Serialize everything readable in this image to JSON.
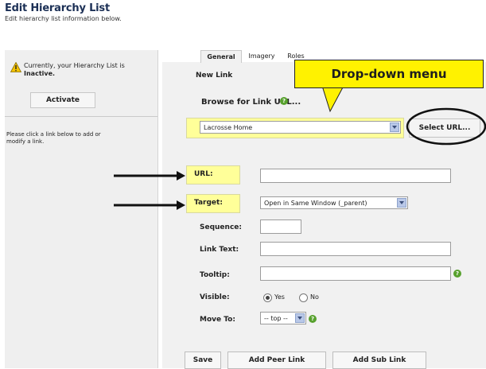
{
  "header": {
    "title": "Edit Hierarchy List",
    "subtitle": "Edit hierarchy list information below."
  },
  "sidebar": {
    "status_prefix": "Currently, your Hierarchy List is",
    "status_value": "Inactive.",
    "activate_label": "Activate",
    "help_text": "Please click a link below to add or modify a link."
  },
  "tabs": [
    "General",
    "Imagery",
    "Roles"
  ],
  "form": {
    "section_title": "New Link",
    "browse_label": "Browse for Link URL...",
    "dropdown_value": "Lacrosse Home",
    "select_url_label": "Select URL...",
    "url_label": "URL:",
    "url_value": "",
    "target_label": "Target:",
    "target_value": "Open in Same Window (_parent)",
    "sequence_label": "Sequence:",
    "link_text_label": "Link Text:",
    "tooltip_label": "Tooltip:",
    "visible_label": "Visible:",
    "visible_yes": "Yes",
    "visible_no": "No",
    "visible_selected": "Yes",
    "move_to_label": "Move To:",
    "move_to_value": "-- top --"
  },
  "actions": {
    "save": "Save",
    "add_peer": "Add Peer Link",
    "add_sub": "Add Sub Link"
  },
  "annotation": {
    "callout_text": "Drop-down menu"
  },
  "colors": {
    "highlight": "#ffff99",
    "callout": "#fff200",
    "title": "#1b2f55",
    "help_icon": "#57a12d"
  }
}
